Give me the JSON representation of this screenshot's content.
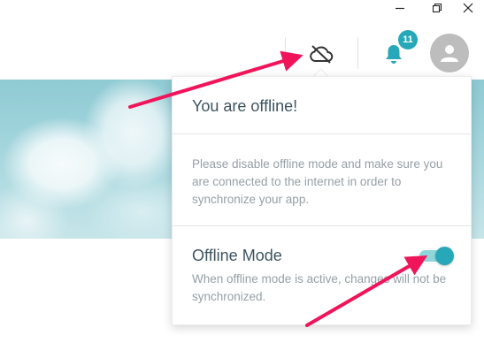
{
  "window_controls": {
    "minimize": "minimize-icon",
    "restore": "restore-icon",
    "close": "close-icon"
  },
  "header": {
    "offline_icon": "cloud-off-icon",
    "notifications_icon": "bell-icon",
    "notification_count": "11",
    "avatar_icon": "user-icon"
  },
  "popup": {
    "title": "You are offline!",
    "message": "Please disable offline mode and make sure you are connected to the internet in order to synchronize your app.",
    "offline_mode_label": "Offline Mode",
    "offline_mode_description": "When offline mode is active, changes will not be synchronized.",
    "offline_mode_enabled": true
  },
  "colors": {
    "accent": "#26a8b8",
    "accent_light": "#8fd6dc",
    "annotation_arrow": "#f0145a",
    "heading_text": "#3d5460",
    "muted_text": "#96a0a6"
  }
}
